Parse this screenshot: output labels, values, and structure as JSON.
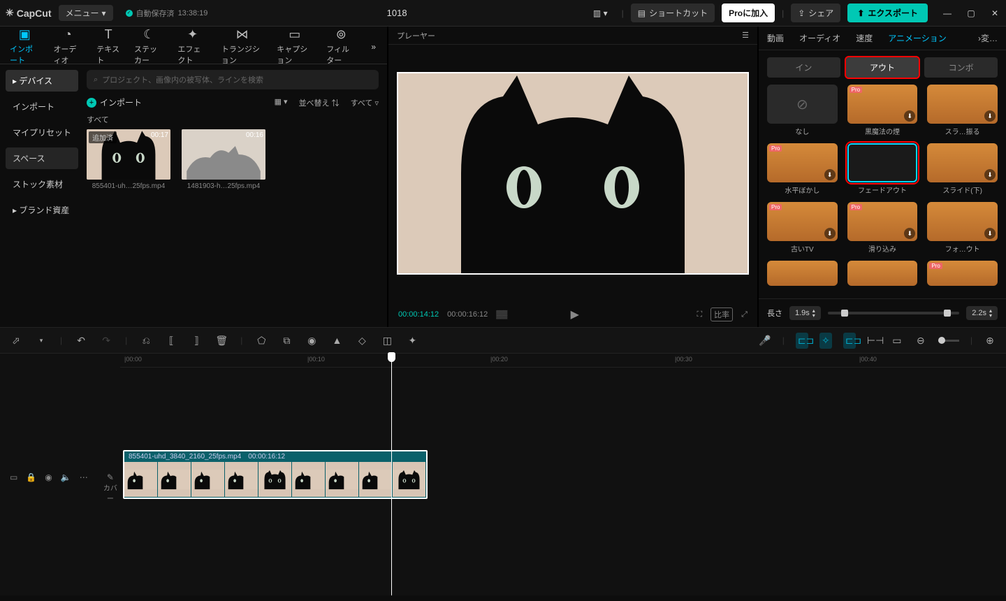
{
  "titlebar": {
    "app": "CapCut",
    "menu": "メニュー",
    "autosave_label": "自動保存済",
    "autosave_time": "13:38:19",
    "project_title": "1018",
    "shortcut": "ショートカット",
    "pro": "Proに加入",
    "share": "シェア",
    "export": "エクスポート"
  },
  "media_tabs": [
    "インポート",
    "オーディオ",
    "テキスト",
    "ステッカー",
    "エフェクト",
    "トランジション",
    "キャプション",
    "フィルター"
  ],
  "sidebar": {
    "items": [
      {
        "label": "デバイス",
        "active": true,
        "arrow": true
      },
      {
        "label": "インポート"
      },
      {
        "label": "マイプリセット"
      },
      {
        "label": "スペース",
        "active": false,
        "bg": true
      },
      {
        "label": "ストック素材"
      },
      {
        "label": "ブランド資産",
        "arrow": true
      }
    ]
  },
  "media": {
    "search_placeholder": "プロジェクト、画像内の被写体、ラインを検索",
    "import": "インポート",
    "sort": "並べ替え",
    "all": "すべて",
    "section": "すべて",
    "items": [
      {
        "badge": "追加済",
        "dur": "00:17",
        "name": "855401-uh…25fps.mp4"
      },
      {
        "dur": "00:16",
        "name": "1481903-h…25fps.mp4"
      }
    ]
  },
  "player": {
    "title": "プレーヤー",
    "timecode_cur": "00:00:14:12",
    "timecode_total": "00:00:16:12",
    "ratio": "比率"
  },
  "inspector": {
    "tabs": [
      "動画",
      "オーディオ",
      "速度",
      "アニメーション",
      "変…"
    ],
    "active_tab": 3,
    "subtabs": [
      "イン",
      "アウト",
      "コンボ"
    ],
    "active_subtab": 1,
    "animations": [
      {
        "label": "なし",
        "none": true
      },
      {
        "label": "黒魔法の煙",
        "pro": true,
        "dl": true
      },
      {
        "label": "スラ…振る",
        "dl": true
      },
      {
        "label": "",
        "hidden": true
      },
      {
        "label": "水平ぼかし",
        "pro": true,
        "dl": true
      },
      {
        "label": "フェードアウト",
        "selected": true,
        "highlight": true
      },
      {
        "label": "スライド(下)",
        "dl": true
      },
      {
        "label": "",
        "hidden": true
      },
      {
        "label": "古いTV",
        "pro": true,
        "dl": true
      },
      {
        "label": "滑り込み",
        "pro": true,
        "dl": true
      },
      {
        "label": "フォ…ウト",
        "dl": true
      },
      {
        "label": "",
        "hidden": true
      }
    ],
    "row4": [
      {
        "pro": false
      },
      {
        "pro": false
      },
      {
        "pro": true
      }
    ],
    "length_label": "長さ",
    "length_val": "1.9s",
    "length_max": "2.2s"
  },
  "timeline": {
    "marks": [
      "|00:00",
      "|00:10",
      "|00:20",
      "|00:30",
      "|00:40"
    ],
    "clip_name": "855401-uhd_3840_2160_25fps.mp4",
    "clip_dur": "00:00:16:12",
    "cover": "カバー"
  }
}
